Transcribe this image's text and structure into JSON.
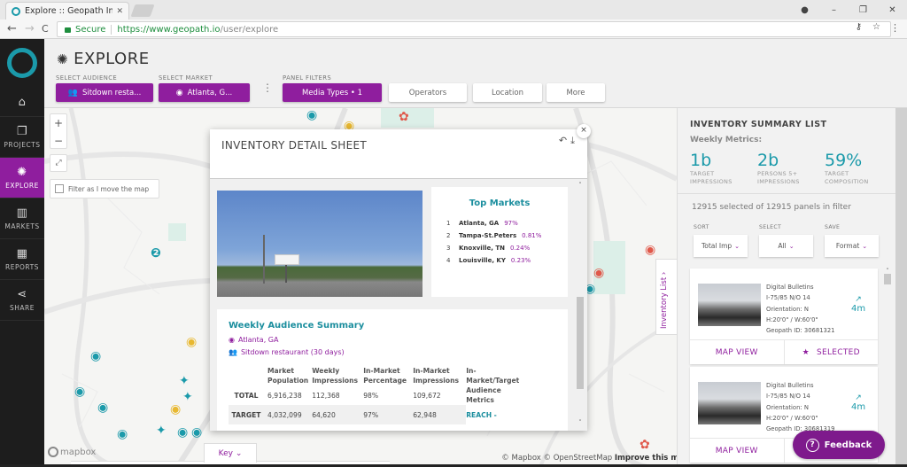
{
  "browser": {
    "tab_title": "Explore :: Geopath Insights",
    "tab_title_short": "Explore :: Geopath Insigh",
    "secure_label": "Secure",
    "url_host": "https://www.geopath.io",
    "url_path": "/user/explore",
    "icons": {
      "back": "←",
      "forward": "→",
      "reload": "C",
      "key": "⚷",
      "star": "☆",
      "menu": "⋮",
      "account": "●",
      "minimize": "–",
      "restore": "❐",
      "close": "✕",
      "tab_close": "✕"
    }
  },
  "sidebar": {
    "items": [
      {
        "label": "",
        "icon": "⌂",
        "name": "home"
      },
      {
        "label": "PROJECTS",
        "icon": "❐",
        "name": "projects"
      },
      {
        "label": "EXPLORE",
        "icon": "✺",
        "name": "explore",
        "active": true
      },
      {
        "label": "MARKETS",
        "icon": "▥",
        "name": "markets"
      },
      {
        "label": "REPORTS",
        "icon": "▦",
        "name": "reports"
      },
      {
        "label": "SHARE",
        "icon": "⋖",
        "name": "share"
      }
    ]
  },
  "header": {
    "title": "EXPLORE",
    "title_icon": "✺",
    "audience_label": "SELECT AUDIENCE",
    "audience_value": "Sitdown resta...",
    "audience_icon": "👥",
    "market_label": "SELECT MARKET",
    "market_value": "Atlanta, G...",
    "market_icon": "◉",
    "panel_filters_label": "PANEL FILTERS",
    "filters": [
      {
        "label": "Media Types  •  1",
        "active": true
      },
      {
        "label": "Operators",
        "active": false
      },
      {
        "label": "Location",
        "active": false
      },
      {
        "label": "More",
        "active": false
      }
    ]
  },
  "map": {
    "zoom_in": "+",
    "zoom_out": "−",
    "fullscreen_icon": "⤢",
    "filter_label": "Filter as I move the map",
    "filter_checked": false,
    "mapbox_label": "mapbox",
    "key_label": "Key ⌄",
    "attribution_mapbox": "© Mapbox",
    "attribution_osm": "© OpenStreetMap",
    "attribution_improve": "Improve this map",
    "inventory_list_tab": "Inventory List ›"
  },
  "detail_sheet": {
    "title": "INVENTORY DETAIL SHEET",
    "undo_icon": "↶",
    "download_icon": "⤓",
    "close_icon": "×",
    "top_markets": {
      "title": "Top Markets",
      "items": [
        {
          "rank": "1",
          "name": "Atlanta, GA",
          "pct": "97%"
        },
        {
          "rank": "2",
          "name": "Tampa-St.Peters",
          "pct": "0.81%"
        },
        {
          "rank": "3",
          "name": "Knoxville, TN",
          "pct": "0.24%"
        },
        {
          "rank": "4",
          "name": "Louisville, KY",
          "pct": "0.23%"
        }
      ]
    },
    "summary": {
      "title": "Weekly Audience Summary",
      "market": "Atlanta, GA",
      "audience": "Sitdown restaurant (30 days)",
      "columns": [
        "",
        "Market Population",
        "Weekly Impressions",
        "In-Market Percentage",
        "In-Market Impressions",
        "In-Market/Target Audience Metrics"
      ],
      "rows": [
        {
          "label": "TOTAL",
          "values": [
            "6,916,238",
            "112,368",
            "98%",
            "109,672"
          ]
        },
        {
          "label": "TARGET",
          "values": [
            "4,032,099",
            "64,620",
            "97%",
            "62,948"
          ]
        }
      ],
      "reach_label": "REACH -"
    }
  },
  "summary_list": {
    "title": "INVENTORY SUMMARY LIST",
    "subtitle": "Weekly Metrics:",
    "metrics": [
      {
        "value": "1b",
        "label1": "TARGET",
        "label2": "IMPRESSIONS"
      },
      {
        "value": "2b",
        "label1": "PERSONS 5+",
        "label2": "IMPRESSIONS"
      },
      {
        "value": "59%",
        "label1": "TARGET",
        "label2": "COMPOSITION"
      }
    ],
    "count_text": "12915 selected of 12915 panels in filter",
    "controls": [
      {
        "label": "SORT",
        "value": "Total Imp"
      },
      {
        "label": "SELECT",
        "value": "All"
      },
      {
        "label": "SAVE",
        "value": "Format"
      }
    ],
    "cards": [
      {
        "type": "Digital Bulletins",
        "location": "I-75/85 N/O 14",
        "orientation": "Orientation: N",
        "size": "H:20'0\" / W:60'0\"",
        "id": "Geopath ID: 30681321",
        "trend": "4m",
        "map_view": "MAP VIEW",
        "select": "SELECTED"
      },
      {
        "type": "Digital Bulletins",
        "location": "I-75/85 N/O 14",
        "orientation": "Orientation: N",
        "size": "H:20'0\" / W:60'0\"",
        "id": "Geopath ID: 30681319",
        "trend": "4m",
        "map_view": "MAP VIEW",
        "select": ""
      }
    ],
    "feedback_label": "Feedback"
  },
  "colors": {
    "purple": "#8f1e9e",
    "teal": "#1b9aaa",
    "dark": "#1d1d1d"
  }
}
